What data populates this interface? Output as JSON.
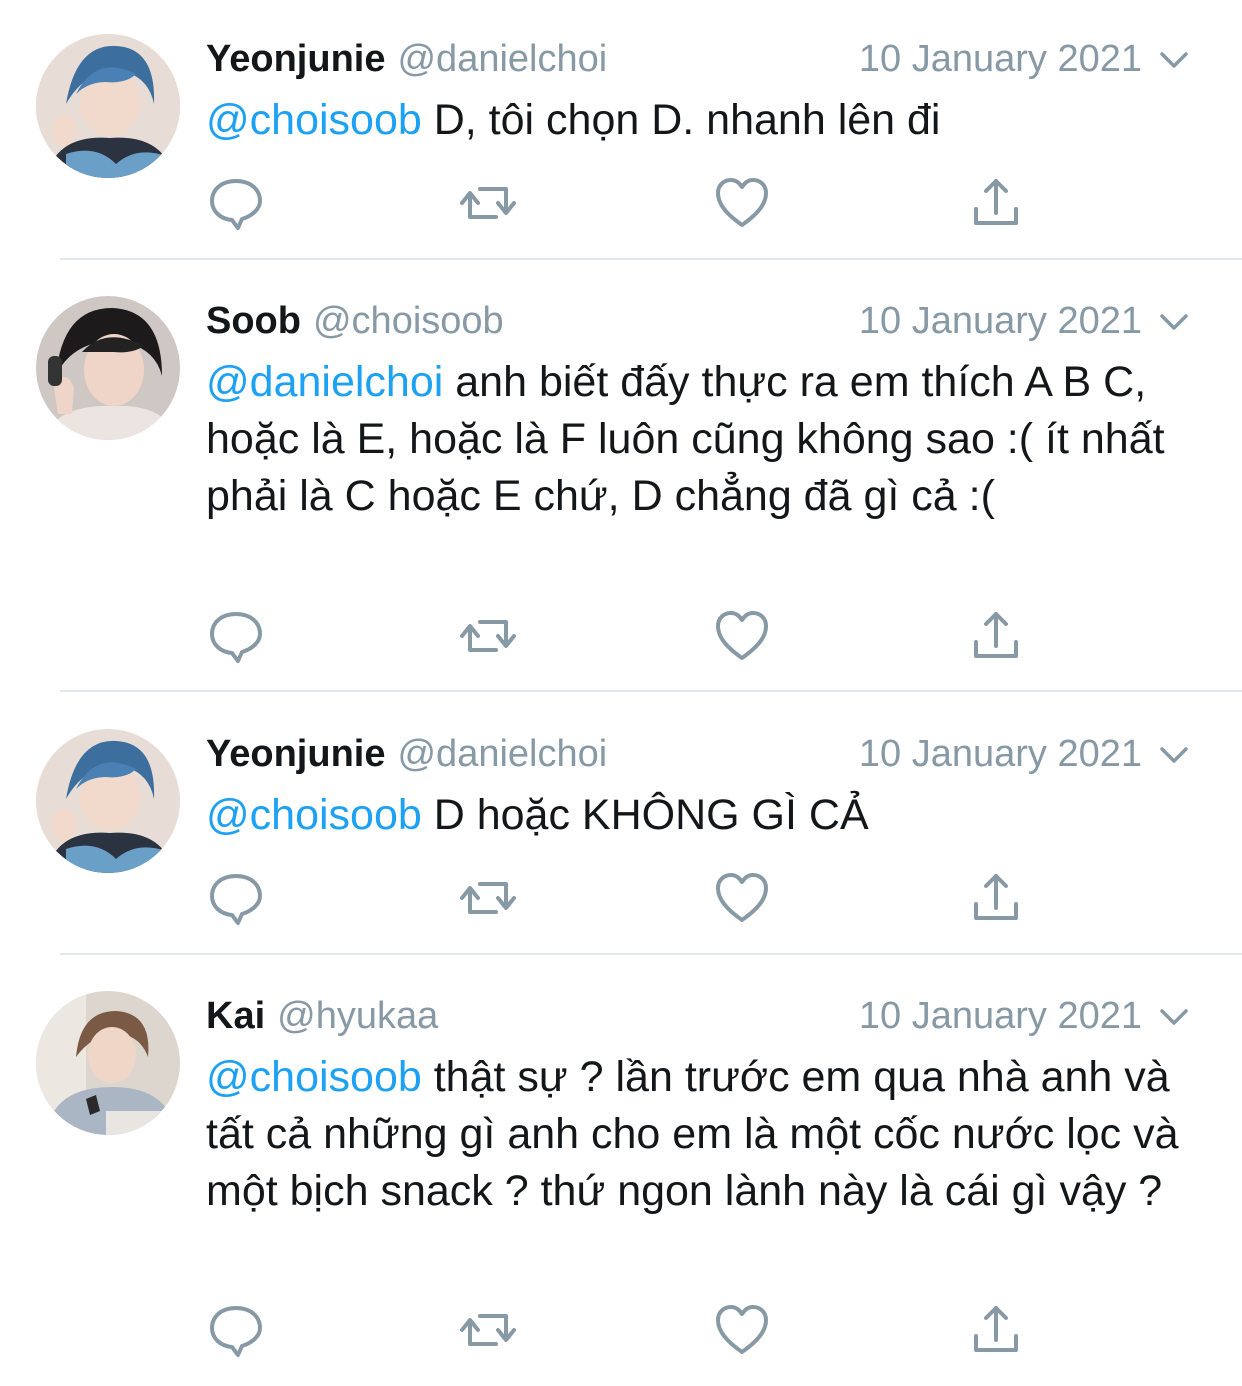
{
  "colors": {
    "mention": "#1da1f2",
    "secondary_text": "#8899a6",
    "icon": "#8899a6",
    "divider": "#e1e8ed"
  },
  "tweets": [
    {
      "author": "Yeonjunie",
      "handle": "@danielchoi",
      "date": "10 January 2021",
      "mention": "@choisoob",
      "text": " D, tôi chọn D. nhanh lên đi"
    },
    {
      "author": "Soob",
      "handle": "@choisoob",
      "date": "10 January 2021",
      "mention": "@danielchoi",
      "text": " anh biết đấy thực ra em thích A B C, hoặc là E, hoặc là F luôn cũng không sao :( ít nhất phải là C hoặc E chứ, D chẳng đã gì cả :("
    },
    {
      "author": "Yeonjunie",
      "handle": "@danielchoi",
      "date": "10 January 2021",
      "mention": "@choisoob",
      "text": " D hoặc KHÔNG GÌ CẢ"
    },
    {
      "author": "Kai",
      "handle": "@hyukaa",
      "date": "10 January 2021",
      "mention": "@choisoob",
      "text": " thật sự ? lần trước em qua nhà anh và tất cả những gì anh cho em là một cốc nước lọc và một bịch snack ? thứ ngon lành này là cái gì vậy ?"
    }
  ],
  "icons": {
    "reply": "reply-icon",
    "retweet": "retweet-icon",
    "like": "heart-icon",
    "share": "share-icon",
    "menu": "chevron-down-icon"
  }
}
